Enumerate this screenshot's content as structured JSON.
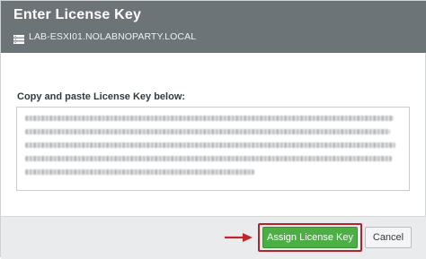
{
  "dialog": {
    "title": "Enter License Key",
    "host_icon": "host-server-icon",
    "host_name": "LAB-ESXI01.NOLABNOPARTY.LOCAL"
  },
  "form": {
    "label": "Copy and paste License Key below:",
    "license_key_value": "(blurred license key text)"
  },
  "footer": {
    "annotation_icon": "red-arrow-icon",
    "assign_label": "Assign License Key",
    "cancel_label": "Cancel"
  },
  "colors": {
    "header_bg": "#6d7478",
    "primary_button": "#4caf43",
    "highlight_border": "#b3232b",
    "annotation_arrow": "#c0272d"
  }
}
